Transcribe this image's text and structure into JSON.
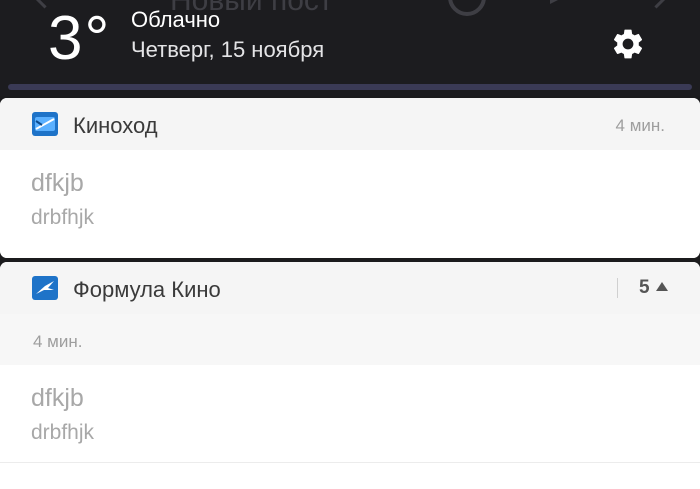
{
  "ghost_bar": {
    "title": "Новый пост",
    "icons": [
      "back-arrow-icon",
      "circle-icon",
      "send-icon",
      "forward-arrow-icon"
    ]
  },
  "header": {
    "temperature": "3°",
    "condition": "Облачно",
    "date": "Четверг, 15 ноября",
    "settings_icon": "gear-icon"
  },
  "notifications": [
    {
      "app_name": "Киноход",
      "app_icon": "kinohod-app-icon",
      "time": "4 мин.",
      "title": "dfkjb",
      "text": "drbfhjk"
    },
    {
      "app_name": "Формула Кино",
      "app_icon": "formula-kino-app-icon",
      "count": "5",
      "sub_time": "4 мин.",
      "title": "dfkjb",
      "text": "drbfhjk"
    }
  ],
  "colors": {
    "header_bg": "#1c1c1f",
    "card_head_bg": "#f5f5f5",
    "muted_text": "#a8a8a8",
    "icon_blue": "#1e73c8"
  }
}
